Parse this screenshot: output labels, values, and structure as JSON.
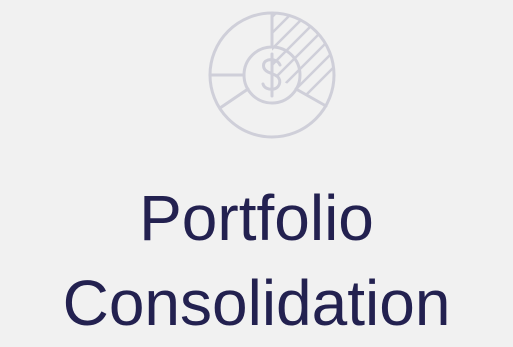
{
  "card": {
    "icon": "pie-chart-dollar-icon",
    "title_line1": "Portfolio",
    "title_line2": "Consolidation",
    "colors": {
      "background": "#f1f1f1",
      "title": "#232150",
      "icon": "#cfcfd9"
    }
  }
}
